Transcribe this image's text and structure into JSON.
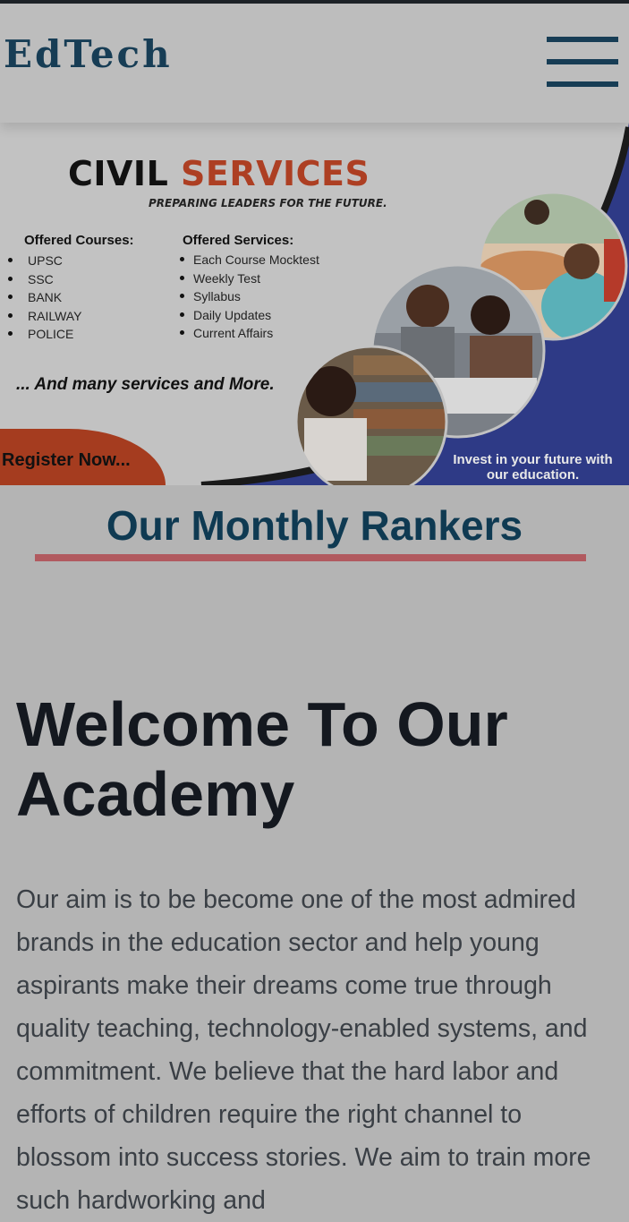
{
  "header": {
    "logo": "EdTech",
    "menu_icon": "hamburger-menu-icon"
  },
  "banner": {
    "title_part1": "CIVIL",
    "title_part2": "SERVICES",
    "tagline": "PREPARING LEADERS FOR THE FUTURE.",
    "courses_heading": "Offered Courses:",
    "courses": [
      "UPSC",
      "SSC",
      "BANK",
      "RAILWAY",
      "POLICE"
    ],
    "services_heading": "Offered Services:",
    "services": [
      "Each Course Mocktest",
      "Weekly Test",
      "Syllabus",
      "Daily Updates",
      "Current Affairs"
    ],
    "more": "... And many services and More.",
    "register": "Register Now...",
    "invest_line1": "Invest in your future with",
    "invest_line2": "our education."
  },
  "sections": {
    "rankers_title": "Our Monthly Rankers",
    "welcome_title": "Welcome To Our Academy",
    "about_text": "Our aim is to be become one of the most admired brands in the education sector and help young aspirants make their dreams come true through quality teaching, technology-enabled systems, and commitment. We believe that the hard labor and efforts of children require the right channel to blossom into success stories. We aim to train more such hardworking and"
  },
  "colors": {
    "brand": "#173d55",
    "accent": "#ad3f23",
    "underline": "#b15a5f",
    "banner_blue": "#2e3a86"
  }
}
